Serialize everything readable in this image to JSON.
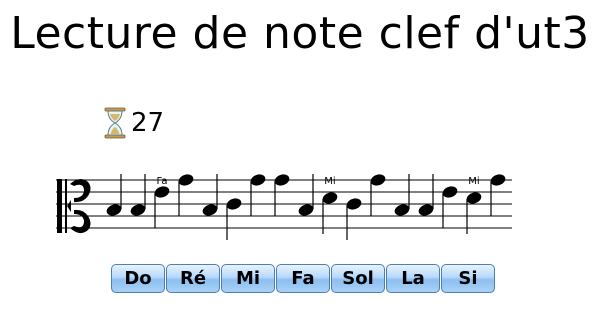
{
  "title": "Lecture de note clef d'ut3",
  "timer": {
    "icon": "hourglass-icon",
    "value": "27"
  },
  "staff": {
    "clef": "alto-clef-icon",
    "notes": [
      {
        "pos": 3,
        "label": ""
      },
      {
        "pos": 3,
        "label": ""
      },
      {
        "pos": 6,
        "label": "Fa"
      },
      {
        "pos": 8,
        "label": ""
      },
      {
        "pos": 3,
        "label": ""
      },
      {
        "pos": 4,
        "label": ""
      },
      {
        "pos": 8,
        "label": ""
      },
      {
        "pos": 8,
        "label": ""
      },
      {
        "pos": 3,
        "label": ""
      },
      {
        "pos": 5,
        "label": "Mi"
      },
      {
        "pos": 4,
        "label": ""
      },
      {
        "pos": 8,
        "label": ""
      },
      {
        "pos": 3,
        "label": ""
      },
      {
        "pos": 3,
        "label": ""
      },
      {
        "pos": 6,
        "label": ""
      },
      {
        "pos": 5,
        "label": "Mi"
      },
      {
        "pos": 8,
        "label": ""
      }
    ]
  },
  "buttons": [
    {
      "id": "do",
      "label": "Do"
    },
    {
      "id": "re",
      "label": "Ré"
    },
    {
      "id": "mi",
      "label": "Mi"
    },
    {
      "id": "fa",
      "label": "Fa"
    },
    {
      "id": "sol",
      "label": "Sol"
    },
    {
      "id": "la",
      "label": "La"
    },
    {
      "id": "si",
      "label": "Si"
    }
  ]
}
